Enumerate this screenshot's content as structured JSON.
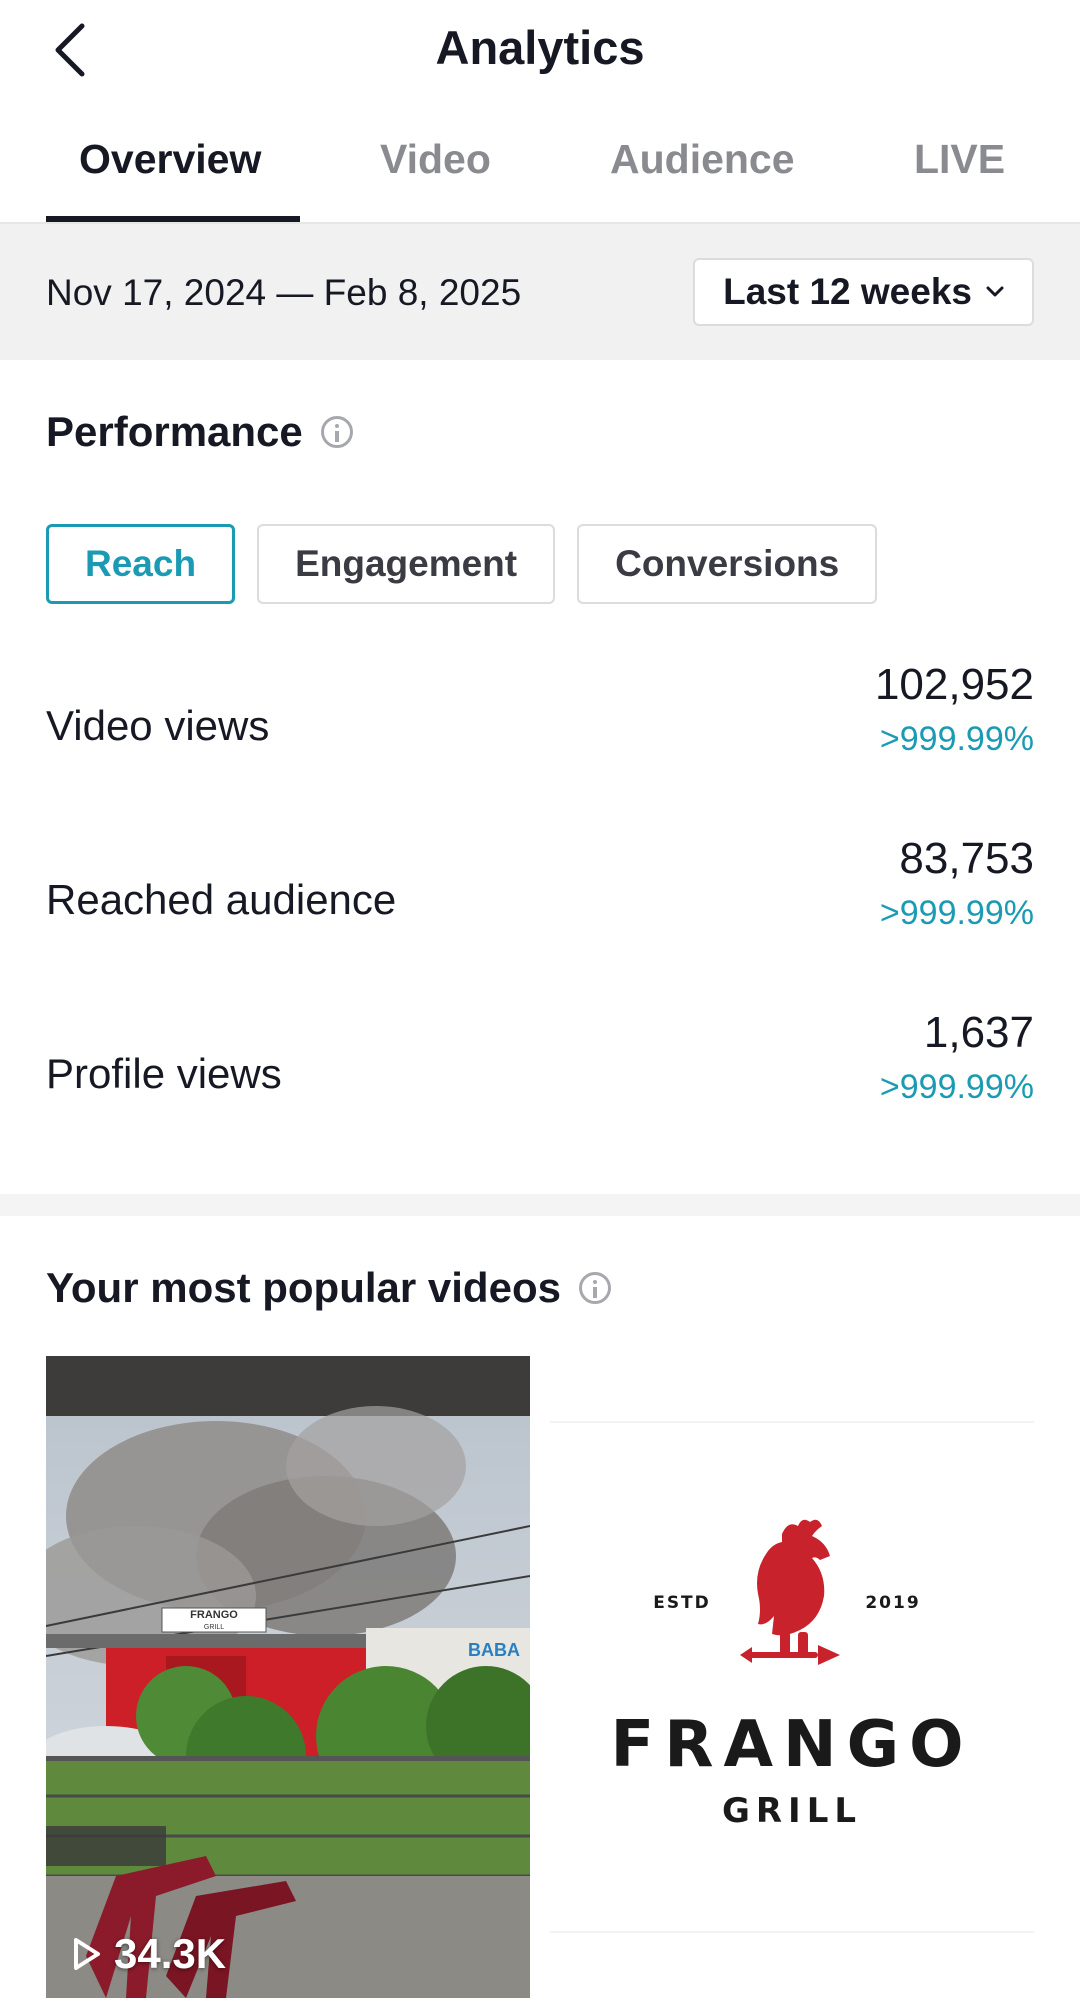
{
  "header": {
    "title": "Analytics"
  },
  "tabs": [
    {
      "label": "Overview",
      "active": true
    },
    {
      "label": "Video",
      "active": false
    },
    {
      "label": "Audience",
      "active": false
    },
    {
      "label": "LIVE",
      "active": false
    }
  ],
  "date_bar": {
    "range": "Nov 17, 2024 — Feb 8, 2025",
    "period": "Last 12 weeks"
  },
  "performance": {
    "title": "Performance",
    "segments": [
      {
        "label": "Reach",
        "active": true
      },
      {
        "label": "Engagement",
        "active": false
      },
      {
        "label": "Conversions",
        "active": false
      }
    ],
    "metrics": [
      {
        "label": "Video views",
        "value": "102,952",
        "change": ">999.99%"
      },
      {
        "label": "Reached audience",
        "value": "83,753",
        "change": ">999.99%"
      },
      {
        "label": "Profile views",
        "value": "1,637",
        "change": ">999.99%"
      }
    ]
  },
  "popular": {
    "title": "Your most popular videos",
    "videos": [
      {
        "views": "34.3K",
        "sign": "FRANGO",
        "sign_sub": "GRILL",
        "neighbor_sign": "BABA"
      },
      {
        "logo_estd": "ESTD",
        "logo_year": "2019",
        "logo_name": "FRANGO",
        "logo_sub": "GRILL"
      }
    ]
  },
  "colors": {
    "accent": "#1b9bb3",
    "text": "#161823",
    "muted": "#8a8b91",
    "brand_red": "#c8232c"
  }
}
